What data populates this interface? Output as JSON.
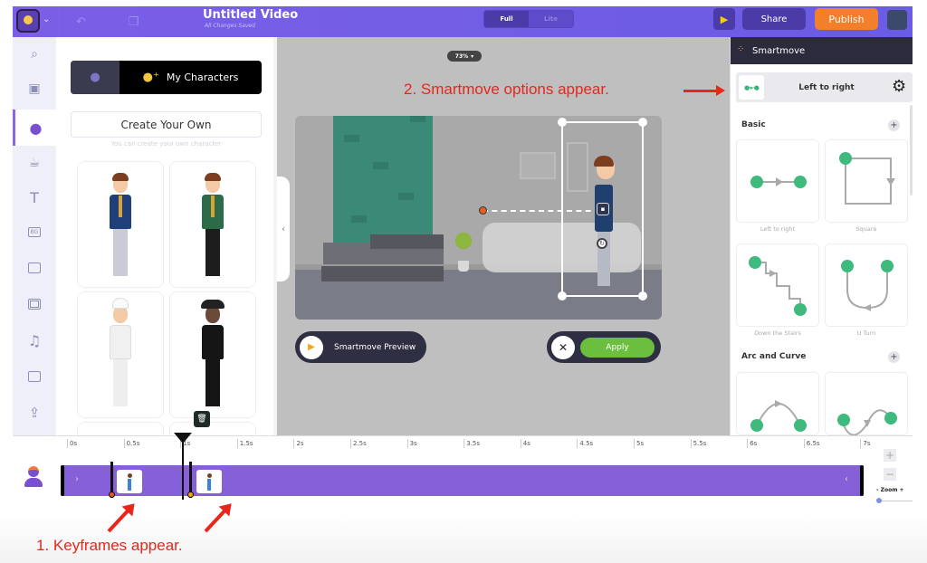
{
  "topbar": {
    "title": "Untitled Video",
    "subtitle": "All Changes Saved",
    "undo_icon": "undo-icon",
    "copy_icon": "duplicate-icon",
    "mode_options": [
      "Full",
      "Lite"
    ],
    "mode_selected": "Full",
    "play_icon": "play-icon",
    "share_label": "Share",
    "publish_label": "Publish",
    "publish_color": "#f47f2b",
    "accent_color": "#7b5ee6"
  },
  "rail": {
    "items": [
      {
        "name": "search",
        "icon": "search-icon",
        "glyph": "⌕"
      },
      {
        "name": "templates",
        "icon": "templates-icon",
        "glyph": "▣"
      },
      {
        "name": "characters",
        "icon": "character-icon",
        "glyph": "●",
        "active": true
      },
      {
        "name": "properties",
        "icon": "props-icon",
        "glyph": "☕"
      },
      {
        "name": "text",
        "icon": "text-icon",
        "glyph": "T"
      },
      {
        "name": "backgrounds",
        "icon": "bg-icon",
        "glyph": "BG"
      },
      {
        "name": "images",
        "icon": "image-icon",
        "glyph": ""
      },
      {
        "name": "videos",
        "icon": "video-icon",
        "glyph": ""
      },
      {
        "name": "music",
        "icon": "music-icon",
        "glyph": "♫"
      },
      {
        "name": "effects",
        "icon": "effects-icon",
        "glyph": ""
      },
      {
        "name": "upload",
        "icon": "upload-icon",
        "glyph": "⇪"
      }
    ]
  },
  "library": {
    "tab_all_icon": "person-icon",
    "tab_my_characters": "My Characters",
    "tab_my_characters_icon": "add-person-icon",
    "create_label": "Create Your Own",
    "create_hint": "You can create your own character",
    "characters": [
      {
        "name": "businessman-blue",
        "shirt": "#1f3f7a",
        "pants": "#c9ccd6"
      },
      {
        "name": "businessman-green",
        "shirt": "#2c6b47",
        "pants": "#1d1d1d"
      },
      {
        "name": "chef",
        "shirt": "#f4f4f4",
        "pants": "#f4f4f4"
      },
      {
        "name": "gentleman-tuxedo",
        "shirt": "#151515",
        "pants": "#151515"
      }
    ],
    "trash_icon": "trash-icon"
  },
  "canvas": {
    "zoom_level": "73%",
    "collapse_icon": "chevron-left-icon",
    "preview_label": "Smartmove Preview",
    "apply_label": "Apply",
    "cancel_icon": "close-icon",
    "rotate_icon": "rotate-icon"
  },
  "annotations": {
    "smartmove": "2. Smartmove options appear.",
    "keyframes": "1. Keyframes appear.",
    "color": "#e8261c"
  },
  "smartmove": {
    "title": "Smartmove",
    "selected": "Left to right",
    "settings_icon": "gear-icon",
    "sections": [
      {
        "title": "Basic",
        "items": [
          "Left to right",
          "Square",
          "Down the Stairs",
          "U Turn"
        ]
      },
      {
        "title": "Arc and Curve",
        "items": [
          "Arc",
          "Wave"
        ]
      }
    ]
  },
  "timeline": {
    "ticks": [
      "0s",
      "0.5s",
      "1s",
      "1.5s",
      "2s",
      "2.5s",
      "3s",
      "3.5s",
      "4s",
      "4.5s",
      "5s",
      "5.5s",
      "6s",
      "6.5s",
      "7s"
    ],
    "playhead_time_s": 1.0,
    "keyframes_s": [
      0.4,
      1.0
    ],
    "zoom_label": "Zoom",
    "zoom_minus": "-",
    "zoom_plus": "+",
    "zoom_value": 0.0
  }
}
